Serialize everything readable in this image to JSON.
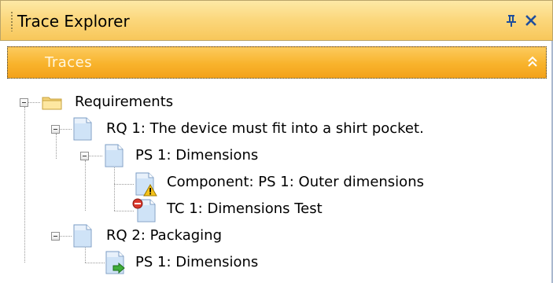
{
  "window": {
    "title": "Trace Explorer"
  },
  "section": {
    "title": "Traces"
  },
  "tree": {
    "root": "Requirements",
    "rq1": "RQ 1: The device must fit into a shirt pocket.",
    "rq1_ps1": "PS 1: Dimensions",
    "component": "Component: PS 1: Outer dimensions",
    "tc1": "TC 1: Dimensions Test",
    "rq2": "RQ 2: Packaging",
    "rq2_ps1": "PS 1: Dimensions"
  },
  "colors": {
    "titlebar": "#fbd77c",
    "section": "#f8b32c",
    "accent_blue": "#1f4e9c"
  },
  "icons": {
    "pin": "pin-icon",
    "close": "close-icon",
    "collapse": "double-chevron-up-icon",
    "folder": "folder-icon",
    "document": "document-icon",
    "warning": "warning-icon",
    "error": "error-icon",
    "link": "link-arrow-icon"
  }
}
